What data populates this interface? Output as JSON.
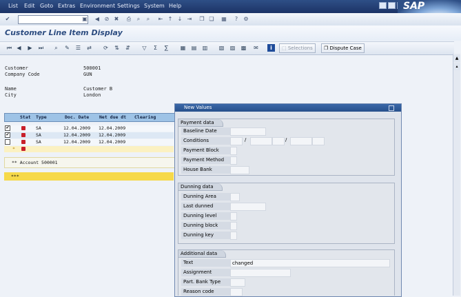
{
  "menu": [
    "List",
    "Edit",
    "Goto",
    "Extras",
    "Environment",
    "Settings",
    "System",
    "Help"
  ],
  "brand": "SAP",
  "page_title": "Customer Line Item Display",
  "toolbar": {
    "selections_label": "Selections",
    "dispute_case_label": "Dispute Case"
  },
  "header": {
    "customer_label": "Customer",
    "customer_value": "500001",
    "company_label": "Company Code",
    "company_value": "GUN",
    "name_label": "Name",
    "name_value": "Customer B",
    "city_label": "City",
    "city_value": "London"
  },
  "table": {
    "columns": [
      "Stat",
      "Type",
      "Doc. Date",
      "Net due dt",
      "Clearing"
    ],
    "rows": [
      {
        "type": "SA",
        "doc_date": "12.04.2009",
        "net_due": "12.04.2009",
        "checked": "✔"
      },
      {
        "type": "SA",
        "doc_date": "12.04.2009",
        "net_due": "12.04.2009",
        "checked": "✔"
      },
      {
        "type": "SA",
        "doc_date": "12.04.2009",
        "net_due": "12.04.2009",
        "checked": ""
      }
    ],
    "total_marker": "*",
    "account_total": "** Account 500001",
    "grand_total": "***"
  },
  "dialog": {
    "title": "New Values",
    "payment": {
      "title": "Payment data",
      "labels": [
        "Baseline Date",
        "Conditions",
        "Payment Block",
        "Payment Method",
        "House Bank"
      ],
      "sep": "/"
    },
    "dunning": {
      "title": "Dunning data",
      "labels": [
        "Dunning Area",
        "Last dunned",
        "Dunning level",
        "Dunning block",
        "Dunning key"
      ]
    },
    "additional": {
      "title": "Additional data",
      "labels": [
        "Text",
        "Assignment",
        "Part. Bank Type",
        "Reason code"
      ],
      "text_value": "changed"
    }
  }
}
